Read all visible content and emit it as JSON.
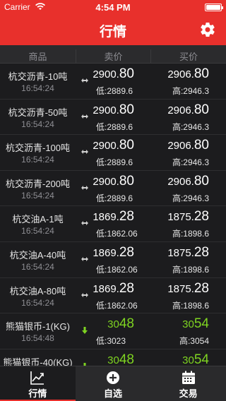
{
  "status_bar": {
    "carrier": "Carrier",
    "time": "4:54 PM"
  },
  "nav": {
    "title": "行情"
  },
  "columns": {
    "product": "商品",
    "sell": "卖价",
    "buy": "买价"
  },
  "rows": [
    {
      "name": "杭交沥青-10吨",
      "time": "16:54:24",
      "trend": "flat",
      "sell_main": "2900.",
      "sell_tail": "80",
      "buy_main": "2906.",
      "buy_tail": "80",
      "low": "低:2889.6",
      "high": "高:2946.3"
    },
    {
      "name": "杭交沥青-50吨",
      "time": "16:54:24",
      "trend": "flat",
      "sell_main": "2900.",
      "sell_tail": "80",
      "buy_main": "2906.",
      "buy_tail": "80",
      "low": "低:2889.6",
      "high": "高:2946.3"
    },
    {
      "name": "杭交沥青-100吨",
      "time": "16:54:24",
      "trend": "flat",
      "sell_main": "2900.",
      "sell_tail": "80",
      "buy_main": "2906.",
      "buy_tail": "80",
      "low": "低:2889.6",
      "high": "高:2946.3"
    },
    {
      "name": "杭交沥青-200吨",
      "time": "16:54:24",
      "trend": "flat",
      "sell_main": "2900.",
      "sell_tail": "80",
      "buy_main": "2906.",
      "buy_tail": "80",
      "low": "低:2889.6",
      "high": "高:2946.3"
    },
    {
      "name": "杭交油A-1吨",
      "time": "16:54:24",
      "trend": "flat",
      "sell_main": "1869.",
      "sell_tail": "28",
      "buy_main": "1875.",
      "buy_tail": "28",
      "low": "低:1862.06",
      "high": "高:1898.6"
    },
    {
      "name": "杭交油A-40吨",
      "time": "16:54:24",
      "trend": "flat",
      "sell_main": "1869.",
      "sell_tail": "28",
      "buy_main": "1875.",
      "buy_tail": "28",
      "low": "低:1862.06",
      "high": "高:1898.6"
    },
    {
      "name": "杭交油A-80吨",
      "time": "16:54:24",
      "trend": "flat",
      "sell_main": "1869.",
      "sell_tail": "28",
      "buy_main": "1875.",
      "buy_tail": "28",
      "low": "低:1862.06",
      "high": "高:1898.6"
    },
    {
      "name": "熊猫银币-1(KG)",
      "time": "16:54:48",
      "trend": "down",
      "sell_main": "30",
      "sell_tail": "48",
      "buy_main": "30",
      "buy_tail": "54",
      "low": "低:3023",
      "high": "高:3054"
    },
    {
      "name": "熊猫银币-40(KG)",
      "time": "",
      "trend": "down",
      "sell_main": "30",
      "sell_tail": "48",
      "buy_main": "30",
      "buy_tail": "54",
      "low": "",
      "high": ""
    }
  ],
  "tabs": [
    {
      "label": "行情",
      "icon": "chart-line-icon",
      "active": true
    },
    {
      "label": "自选",
      "icon": "plus-circle-icon",
      "active": false
    },
    {
      "label": "交易",
      "icon": "calendar-icon",
      "active": false
    }
  ],
  "colors": {
    "accent": "#e8302c",
    "up_green": "#7ed321",
    "background": "#1c1c1e"
  }
}
